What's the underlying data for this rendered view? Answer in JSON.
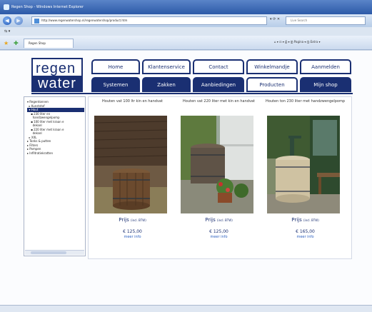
{
  "browser": {
    "title": "Regen Shop - Windows Internet Explorer",
    "url": "http://www.regenwatershop.nl/regenwatershop/product.htm",
    "search_placeholder": "Live Search",
    "menu_text": "⇆ ▾",
    "tab_title": "Regen Shop",
    "command_icons": "⌂ ▾ ⊡ ▾ ⎙ ▾ ⓟ Pagina ▾ ⓧ Extra ▾"
  },
  "logo": {
    "line1": "regen",
    "line2": "water"
  },
  "nav_top": [
    "Home",
    "Klantenservice",
    "Contact",
    "Winkelmandje",
    "Aanmelden"
  ],
  "nav_bottom": [
    "Systemen",
    "Zakken",
    "Aanbiedingen",
    "Producten",
    "Mijn shop"
  ],
  "nav_active": "Producten",
  "sidebar": {
    "items": [
      {
        "label": "▾ Regentonnen",
        "selected": false
      },
      {
        "label": "  ▸ Kunststof",
        "selected": false
      },
      {
        "label": "  ▾ Hout",
        "selected": true
      },
      {
        "label": "    ▪ 230 liter en",
        "selected": false
      },
      {
        "label": "      handzwengelpomp",
        "selected": false
      },
      {
        "label": "    ▪ 100 liter met kraan e",
        "selected": false
      },
      {
        "label": "      deksel",
        "selected": false
      },
      {
        "label": "    ▪ 220 liter met kraan e",
        "selected": false
      },
      {
        "label": "      deksel",
        "selected": false
      },
      {
        "label": "  ▸ XXL",
        "selected": false
      },
      {
        "label": "▸ Tanks & putten",
        "selected": false
      },
      {
        "label": "▸ Filters",
        "selected": false
      },
      {
        "label": "▸ Pompen",
        "selected": false
      },
      {
        "label": "▸ Infiltratiekratten",
        "selected": false
      }
    ]
  },
  "products": [
    {
      "name": "Houten vat 100 ltr kin en handvat",
      "price_label": "Prijs",
      "price_note": "(incl. BTW)",
      "price": "€ 125,00",
      "more": "meer info"
    },
    {
      "name": "Houten vat 220 liter met kin en handvat",
      "price_label": "Prijs",
      "price_note": "(incl. BTW)",
      "price": "€ 125,00",
      "more": "meer info"
    },
    {
      "name": "Houten ton 230 liter met handzwengelpomp",
      "price_label": "Prijs",
      "price_note": "(incl. BTW)",
      "price": "€ 165,00",
      "more": "meer info"
    }
  ],
  "colors": {
    "brand": "#1a2f72",
    "link": "#2a5fc0",
    "chrome": "#2c5aa8"
  }
}
